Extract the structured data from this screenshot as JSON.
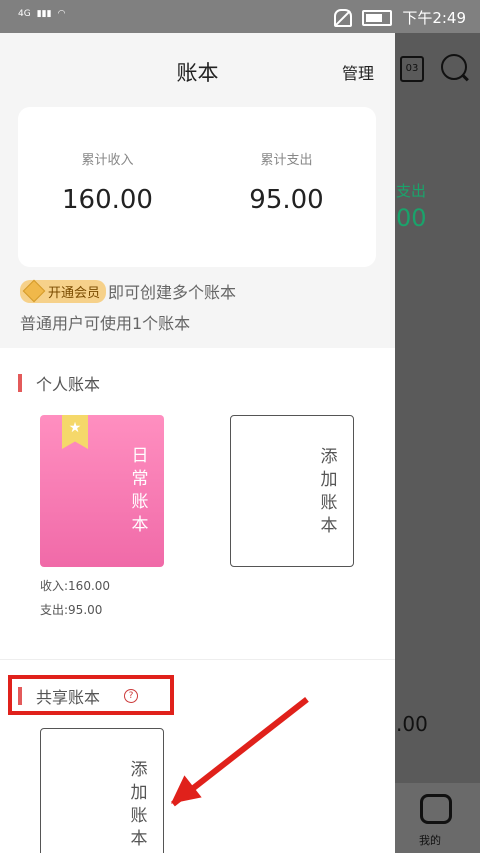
{
  "status": {
    "network": "4G",
    "time": "下午2:49"
  },
  "header": {
    "title": "账本",
    "manage_label": "管理"
  },
  "summary": {
    "income_label": "累计收入",
    "income_value": "160.00",
    "expense_label": "累计支出",
    "expense_value": "95.00"
  },
  "vip": {
    "badge": "开通会员",
    "text": "即可创建多个账本",
    "note": "普通用户可使用1个账本"
  },
  "personal": {
    "section_title": "个人账本",
    "daily_book": {
      "name": "日常账本",
      "income": "收入:160.00",
      "expense": "支出:95.00"
    },
    "add_label": "添加账本"
  },
  "shared": {
    "section_title": "共享账本",
    "add_label": "添加账本"
  },
  "background": {
    "calendar_day": "03",
    "expense_label": "支出",
    "value1": "00",
    "value2": ".00",
    "tab_label": "我的"
  },
  "colors": {
    "accent_red": "#e35a5a",
    "highlight_red": "#e0211b",
    "pink_book": "#f06aa8",
    "green": "#1aa36b"
  }
}
